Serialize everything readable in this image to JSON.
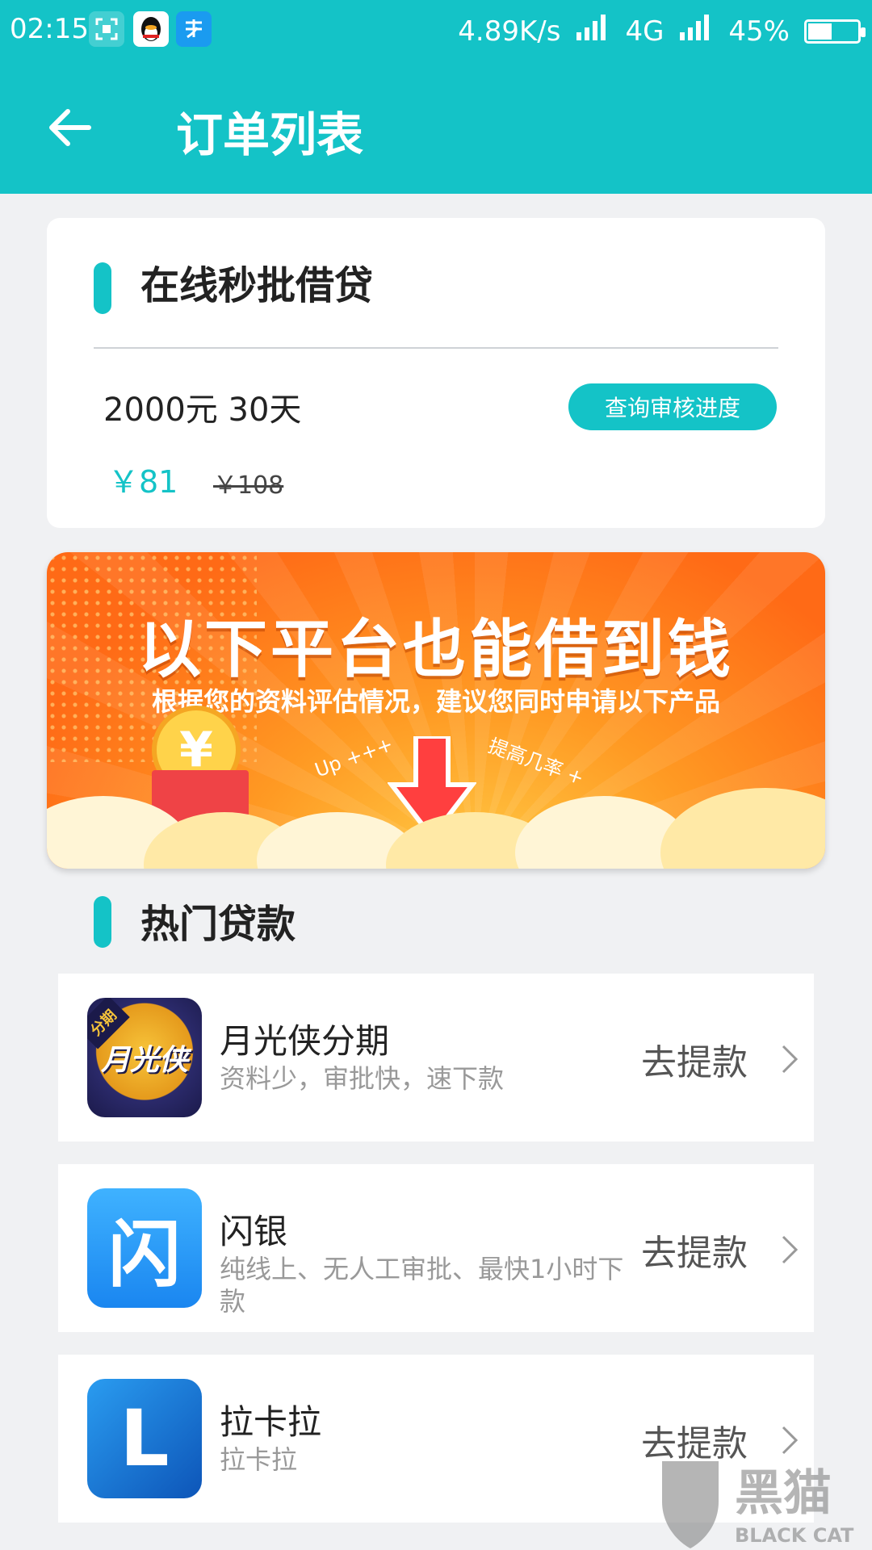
{
  "status_bar": {
    "time": "02:15",
    "net_speed": "4.89K/s",
    "network": "4G",
    "battery": "45%",
    "battery_level": 0.45,
    "icons": [
      "screenshot-icon",
      "qq-icon",
      "alipay-icon",
      "signal-icon",
      "battery-icon"
    ]
  },
  "app_bar": {
    "title": "订单列表",
    "back_icon": "arrow-left-icon"
  },
  "order_card": {
    "title": "在线秒批借贷",
    "loan_info": "2000元 30天",
    "query_button": "查询审核进度",
    "price": "￥81",
    "original_price": "￥108"
  },
  "banner": {
    "headline": "以下平台也能借到钱",
    "subline": "根据您的资料评估情况，建议您同时申请以下产品",
    "tag_left": "Up +++",
    "tag_right": "提高几率 +",
    "coin_symbol": "¥"
  },
  "hot_section": {
    "title": "热门贷款"
  },
  "loan_items": [
    {
      "name": "月光侠分期",
      "desc": "资料少，审批快，速下款",
      "action": "去提款",
      "icon_text": "月光侠",
      "icon_badge": "分期"
    },
    {
      "name": "闪银",
      "desc": "纯线上、无人工审批、最快1小时下款",
      "action": "去提款",
      "icon_text": "闪"
    },
    {
      "name": "拉卡拉",
      "desc": "拉卡拉",
      "action": "去提款",
      "icon_text": "L"
    }
  ],
  "watermark": {
    "cn": "黑猫",
    "en": "BLACK CAT"
  },
  "colors": {
    "accent": "#14c3c7",
    "banner": "#ff7a1a",
    "strike": "#444444"
  }
}
